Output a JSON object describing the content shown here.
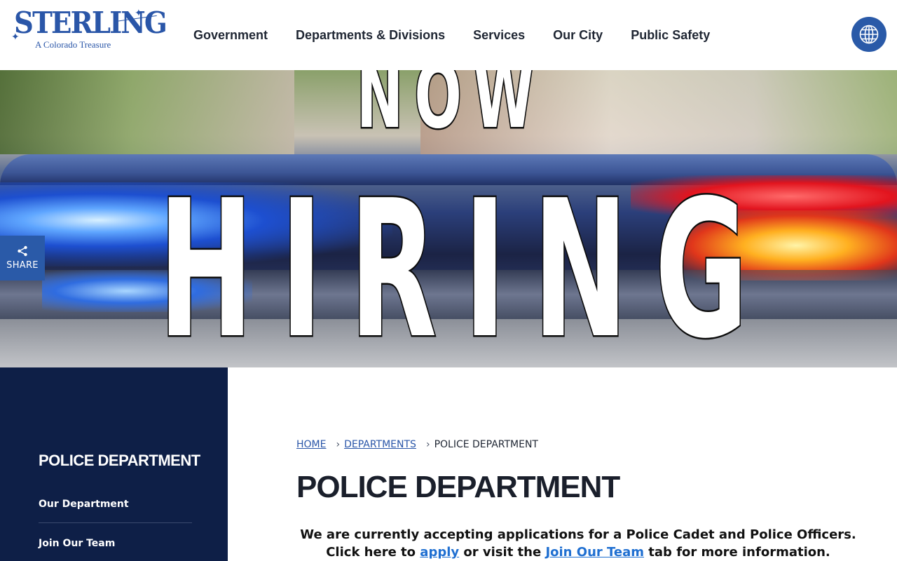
{
  "header": {
    "logo": {
      "word": "STERLING",
      "tagline": "A Colorado Treasure"
    },
    "nav": [
      {
        "label": "Government"
      },
      {
        "label": "Departments & Divisions"
      },
      {
        "label": "Services"
      },
      {
        "label": "Our City"
      },
      {
        "label": "Public Safety"
      }
    ],
    "language_button_icon": "globe-icon"
  },
  "hero": {
    "line1": "NOW",
    "line2": "HIRING"
  },
  "share": {
    "icon": "share-icon",
    "label": "SHARE"
  },
  "sidebar": {
    "title": "POLICE DEPARTMENT",
    "items": [
      {
        "label": "Our Department"
      },
      {
        "label": "Join Our Team"
      }
    ]
  },
  "main": {
    "breadcrumb": {
      "home": "HOME",
      "departments": "DEPARTMENTS",
      "current": "POLICE DEPARTMENT",
      "separator": "›"
    },
    "title": "POLICE DEPARTMENT",
    "intro": {
      "line1": "We are currently accepting applications for a Police Cadet and Police Officers.",
      "pre_apply": "Click here to ",
      "apply_link": "apply",
      "mid": " or visit the ",
      "join_link": "Join Our Team",
      "post": " tab for more information."
    }
  },
  "colors": {
    "brand_blue": "#2a56a8",
    "sidebar_navy": "#0e1f47",
    "link_blue": "#1f6fd1"
  }
}
